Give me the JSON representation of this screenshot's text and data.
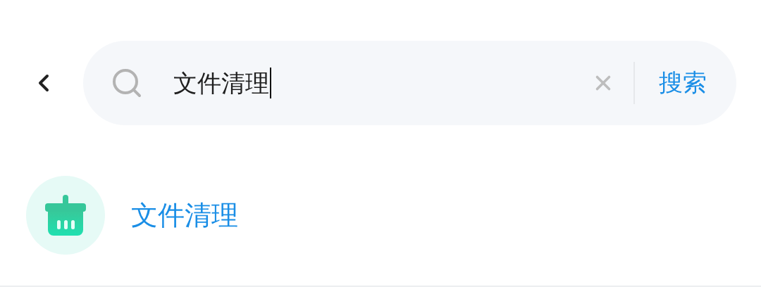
{
  "search": {
    "value": "文件清理",
    "button": "搜索"
  },
  "results": [
    {
      "label": "文件清理"
    }
  ]
}
